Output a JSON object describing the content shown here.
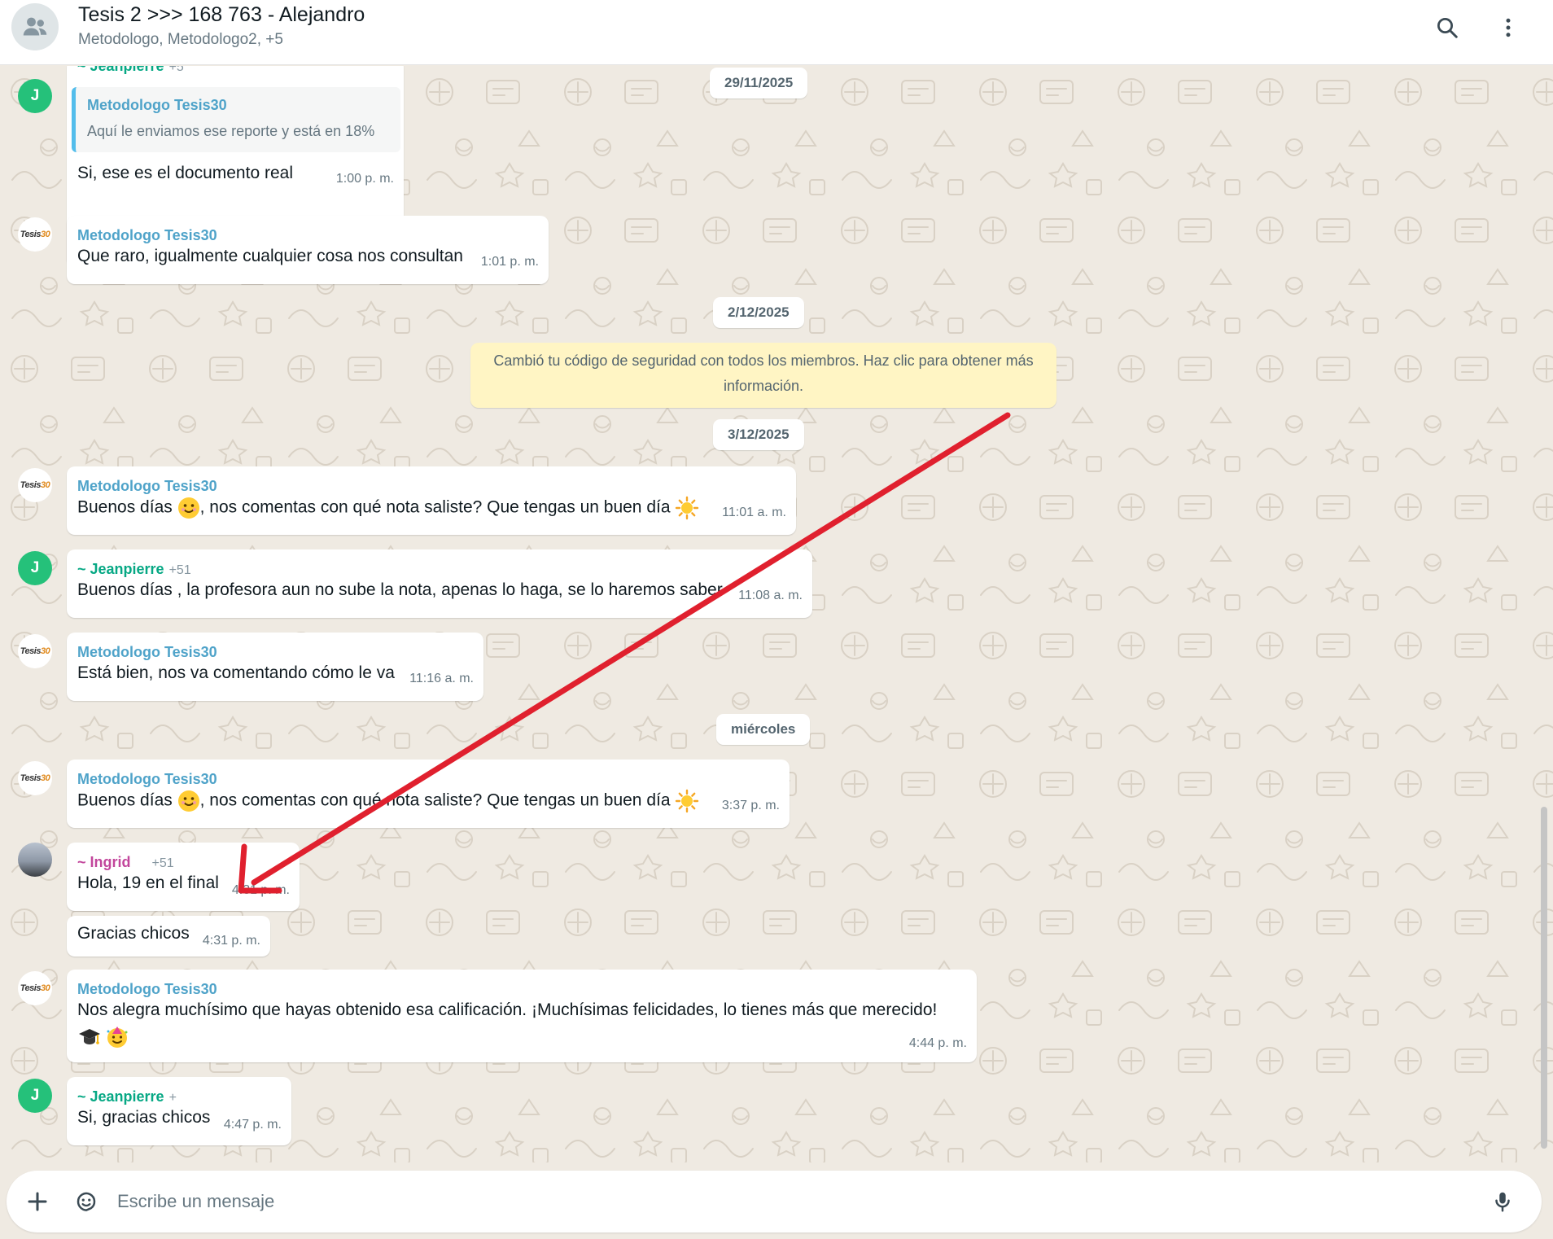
{
  "header": {
    "title": "Tesis 2 >>> 168 763 - Alejandro",
    "subtitle": "Metodologo, Metodologo2, +5",
    "icons": [
      "group-icon",
      "search-icon",
      "menu-dots-icon"
    ]
  },
  "dates": {
    "d1": "29/11/2025",
    "d2": "2/12/2025",
    "d3": "3/12/2025",
    "d4": "miércoles"
  },
  "system_message": "Cambió tu código de seguridad con todos los miembros. Haz clic para obtener más información.",
  "messages": {
    "m1": {
      "sender": "~ Jeanpierre",
      "phone": "+5",
      "quote_sender": "Metodologo Tesis30",
      "quote_text": "Aquí le enviamos ese reporte y está en 18%",
      "text": "Si, ese es el documento real",
      "time": "1:00 p. m.",
      "avatar": "J"
    },
    "m2": {
      "sender": "Metodologo Tesis30",
      "text": "Que raro, igualmente cualquier cosa nos consultan",
      "time": "1:01 p. m."
    },
    "m3": {
      "sender": "Metodologo Tesis30",
      "text_a": "Buenos días",
      "text_b": ", nos comentas con qué nota saliste? Que tengas un buen día",
      "time": "11:01 a. m."
    },
    "m4": {
      "sender": "~ Jeanpierre",
      "phone": "+51",
      "text": "Buenos días , la profesora aun no sube la nota, apenas lo haga, se lo haremos saber",
      "time": "11:08 a. m.",
      "avatar": "J"
    },
    "m5": {
      "sender": "Metodologo Tesis30",
      "text": "Está bien, nos va comentando cómo le va",
      "time": "11:16 a. m."
    },
    "m6": {
      "sender": "Metodologo Tesis30",
      "text_a": "Buenos días",
      "text_b": ", nos comentas con qué nota saliste? Que tengas un buen día",
      "time": "3:37 p. m."
    },
    "m7": {
      "sender": "~ Ingrid",
      "phone": "+51",
      "text": "Hola, 19 en el final",
      "time": "4:31 p. m."
    },
    "m8": {
      "text": "Gracias chicos",
      "time": "4:31 p. m."
    },
    "m9": {
      "sender": "Metodologo Tesis30",
      "text": "Nos alegra muchísimo que hayas obtenido esa calificación. ¡Muchísimas felicidades, lo tienes más que merecido!",
      "time": "4:44 p. m."
    },
    "m10": {
      "sender": "~ Jeanpierre",
      "phone": "+",
      "text": "Si, gracias chicos",
      "time": "4:47 p. m.",
      "avatar": "J"
    }
  },
  "avatar_logo": {
    "a": "Tesis",
    "b": "30"
  },
  "composer": {
    "placeholder": "Escribe un mensaje",
    "icons": [
      "plus-icon",
      "sticker-icon",
      "microphone-icon"
    ]
  },
  "colors": {
    "chat_background": "#efeae2",
    "bubble": "#ffffff",
    "system_message": "#fff5c4",
    "sender_metodologo": "#4fa3c9",
    "sender_jeanpierre": "#06a884",
    "sender_ingrid": "#c2469c",
    "avatar_green": "#25c17a",
    "annotation_arrow": "#e0202e"
  }
}
